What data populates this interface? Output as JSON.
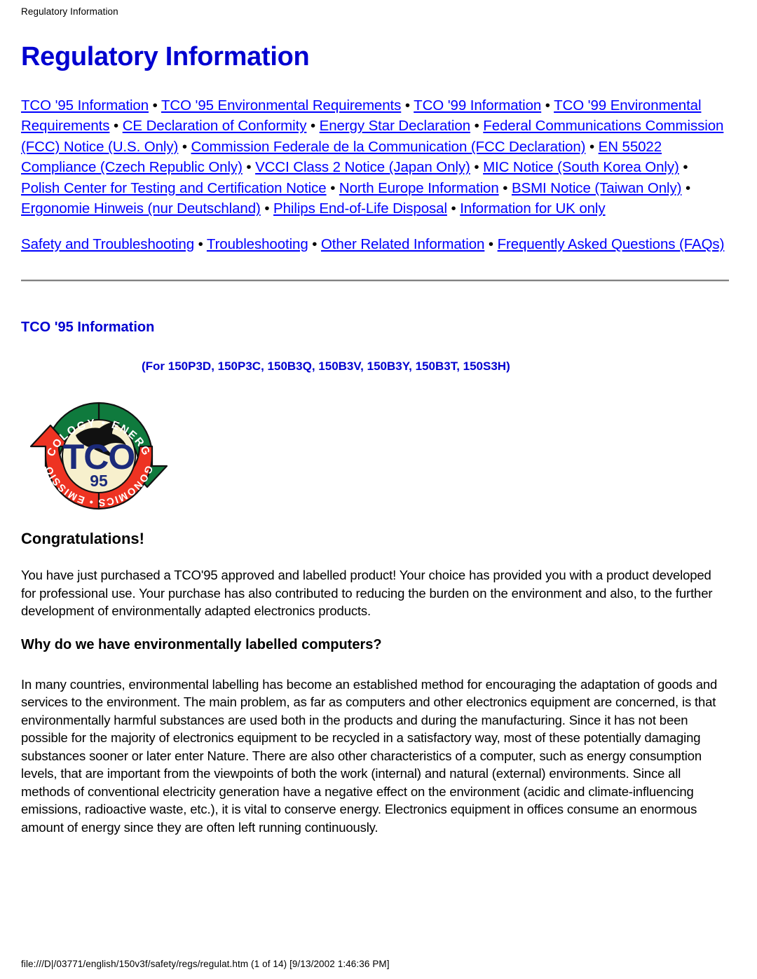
{
  "document": {
    "running_header": "Regulatory Information",
    "title": "Regulatory Information"
  },
  "nav": {
    "separator": " • ",
    "primary_links": [
      "TCO '95 Information",
      "TCO '95 Environmental Requirements",
      "TCO '99 Information",
      "TCO '99 Environmental Requirements",
      "CE Declaration of Conformity",
      "Energy Star Declaration",
      "Federal Communications Commission (FCC) Notice (U.S. Only)",
      "Commission Federale de la Communication (FCC Declaration)",
      "EN 55022 Compliance (Czech Republic Only)",
      "VCCI Class 2 Notice (Japan Only)",
      "MIC Notice (South Korea Only)",
      "Polish Center for Testing and Certification Notice",
      "North Europe Information",
      "BSMI Notice (Taiwan Only)",
      "Ergonomie Hinweis (nur Deutschland)",
      "Philips End-of-Life Disposal",
      "Information for UK only"
    ],
    "secondary_links": [
      "Safety and Troubleshooting",
      "Troubleshooting",
      "Other Related Information",
      "Frequently Asked Questions (FAQs)"
    ]
  },
  "section": {
    "heading": "TCO '95 Information",
    "models": "(For 150P3D, 150P3C, 150B3Q, 150B3V, 150B3Y, 150B3T, 150S3H)",
    "congratulations_heading": "Congratulations!",
    "intro_paragraph": "You have just purchased a TCO'95 approved and labelled product! Your choice has provided you with a product developed for professional use. Your purchase has also contributed to reducing the burden on the environment and also, to the further development of environmentally adapted electronics products.",
    "subheading": "Why do we have environmentally labelled computers?",
    "body_paragraph": "In many countries, environmental labelling has become an established method for encouraging the adaptation of goods and services to the environment. The main problem, as far as computers and other electronics equipment are concerned, is that environmentally harmful substances are used both in the products and during the manufacturing. Since it has not been possible for the majority of electronics equipment to be recycled in a satisfactory way, most of these potentially damaging substances sooner or later enter Nature. There are also other characteristics of a computer, such as energy consumption levels, that are important from the viewpoints of both the work (internal) and natural (external) environments. Since all methods of conventional electricity generation have a negative effect on the environment (acidic and climate-influencing emissions, radioactive waste, etc.), it is vital to conserve energy. Electronics equipment in offices consume an enormous amount of energy since they are often left running continuously."
  },
  "logo": {
    "name": "TCO '95 certification logo",
    "top_arc_text": "ECOLOGY • ENERGY",
    "bottom_arc_text": "ERGONOMICS • EMISSIONS",
    "center_text": "TCO",
    "year_text": "95",
    "colors": {
      "green": "#0f7a3d",
      "red": "#ee3322",
      "cream": "#f7f0cd",
      "navy": "#1b2a7a",
      "black": "#111111"
    }
  },
  "footer": {
    "status": "file:///D|/03771/english/150v3f/safety/regs/regulat.htm (1 of 14) [9/13/2002 1:46:36 PM]"
  },
  "theme": {
    "link_color": "#0000ff",
    "title_color": "#0000d0",
    "text_color": "#000000",
    "background": "#ffffff"
  }
}
